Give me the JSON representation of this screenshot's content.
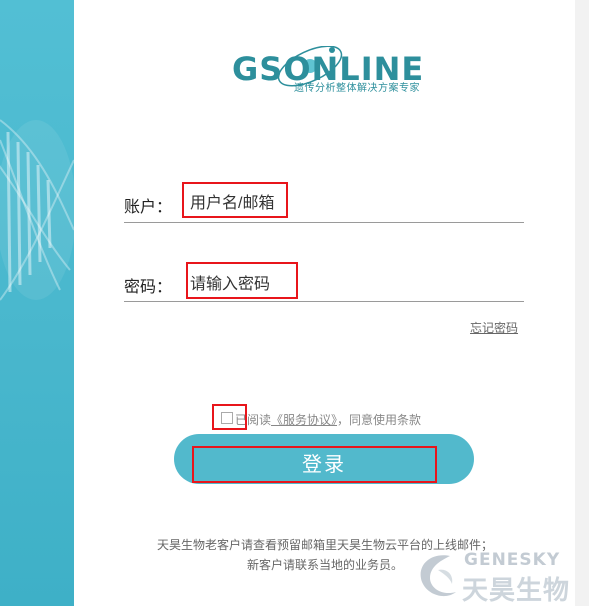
{
  "logo": {
    "brand": "GSONLINE",
    "tagline": "遗传分析整体解决方案专家"
  },
  "account": {
    "label": "账户：",
    "placeholder": "用户名/邮箱"
  },
  "password": {
    "label": "密码：",
    "placeholder": "请输入密码"
  },
  "forgot_password": "忘记密码",
  "agreement": {
    "prefix": "已阅读",
    "link": "《服务协议》",
    "suffix": "，同意使用条款",
    "checked": false
  },
  "login_button": "登录",
  "footer": {
    "line1": "天昊生物老客户请查看预留邮箱里天昊生物云平台的上线邮件；",
    "line2": "新客户请联系当地的业务员。"
  },
  "watermark": {
    "en": "GENESKY",
    "cn": "天昊生物"
  },
  "colors": {
    "accent": "#52b9cc",
    "brand": "#2d8f9c",
    "highlight": "#e8151b"
  }
}
